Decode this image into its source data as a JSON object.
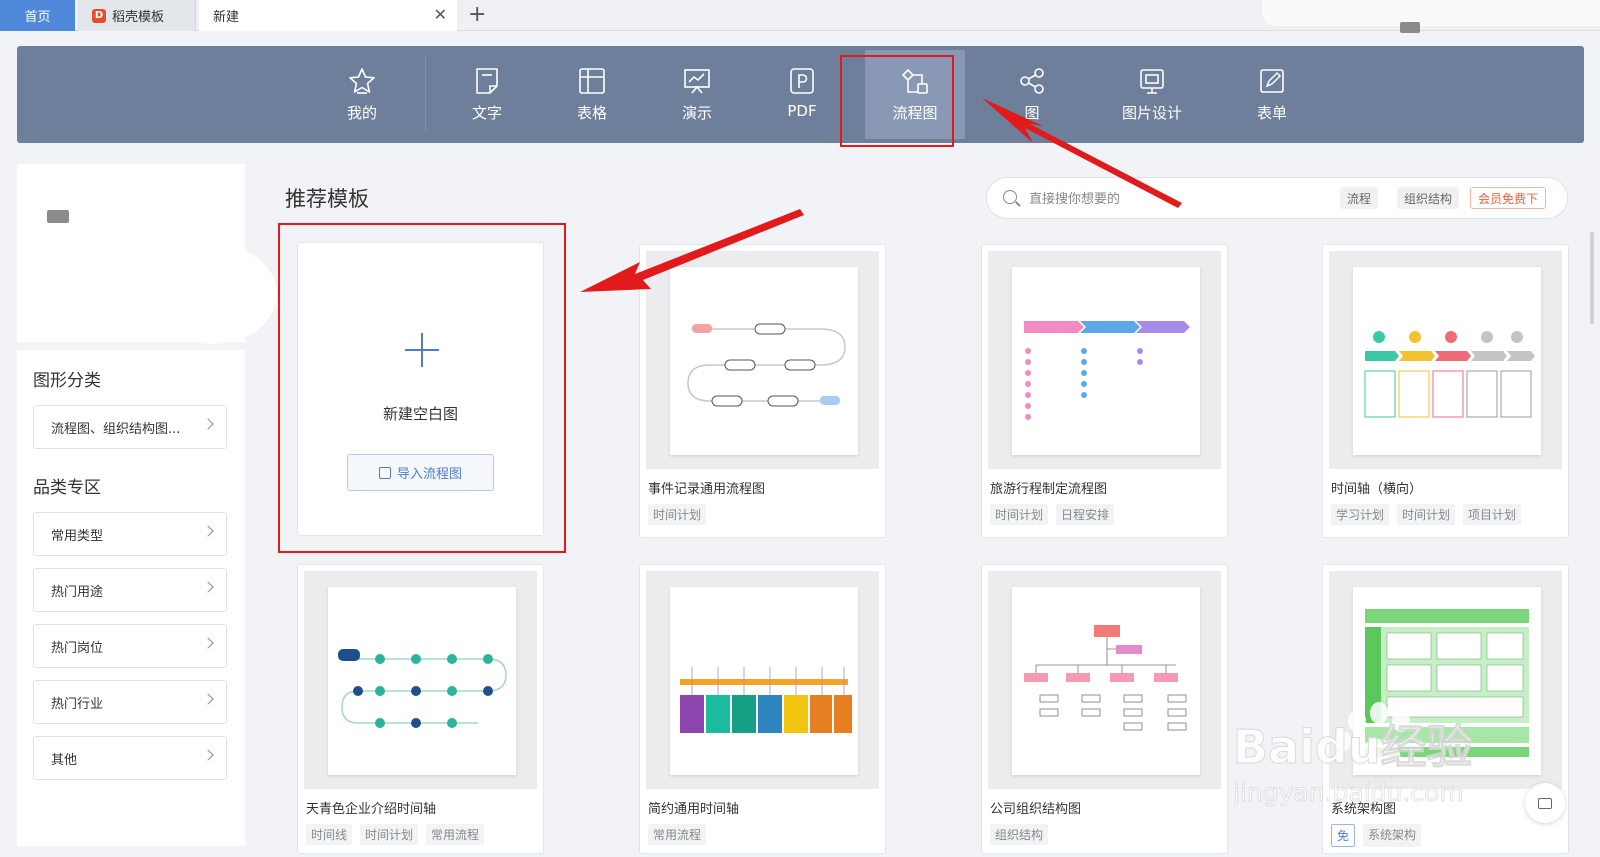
{
  "tabs": [
    {
      "label": "首页"
    },
    {
      "label": "稻壳模板",
      "icon": "daoke-logo-icon"
    },
    {
      "label": "新建"
    }
  ],
  "toolbar": {
    "items": [
      {
        "label": "我的",
        "icon": "star-icon"
      },
      {
        "label": "文字",
        "icon": "document-icon"
      },
      {
        "label": "表格",
        "icon": "table-icon"
      },
      {
        "label": "演示",
        "icon": "presentation-icon"
      },
      {
        "label": "PDF",
        "icon": "pdf-icon"
      },
      {
        "label": "流程图",
        "icon": "flowchart-icon",
        "active": true
      },
      {
        "label": "图",
        "icon": "mindmap-icon"
      },
      {
        "label": "图片设计",
        "icon": "image-design-icon"
      },
      {
        "label": "表单",
        "icon": "form-icon"
      }
    ]
  },
  "sidebar": {
    "category_title": "图形分类",
    "category_select": "流程图、组织结构图...",
    "zone_title": "品类专区",
    "zone_items": [
      "常用类型",
      "热门用途",
      "热门岗位",
      "热门行业",
      "其他"
    ]
  },
  "main": {
    "section_title": "推荐模板",
    "search": {
      "placeholder": "直接搜你想要的",
      "chips": [
        "流程",
        "组织结构",
        "会员免费下"
      ]
    },
    "blank": {
      "label": "新建空白图",
      "import_label": "导入流程图"
    },
    "cards": [
      {
        "name": "事件记录通用流程图",
        "tags": [
          "时间计划"
        ]
      },
      {
        "name": "旅游行程制定流程图",
        "tags": [
          "时间计划",
          "日程安排"
        ]
      },
      {
        "name": "时间轴（横向）",
        "tags": [
          "学习计划",
          "时间计划",
          "项目计划"
        ]
      },
      {
        "name": "天青色企业介绍时间轴",
        "tags": [
          "时间线",
          "时间计划",
          "常用流程"
        ]
      },
      {
        "name": "简约通用时间轴",
        "tags": [
          "常用流程"
        ]
      },
      {
        "name": "公司组织结构图",
        "tags": [
          "组织结构"
        ]
      },
      {
        "name": "系统架构图",
        "tags": [
          "免",
          "系统架构"
        ]
      }
    ]
  },
  "watermark": {
    "brand": "Baidu经验",
    "url": "jingyan.baidu.com"
  },
  "colors": {
    "toolbar_bg": "#6e7f9c",
    "accent": "#4f7cc9",
    "highlight": "#e11b1b",
    "vip": "#e8603c"
  }
}
